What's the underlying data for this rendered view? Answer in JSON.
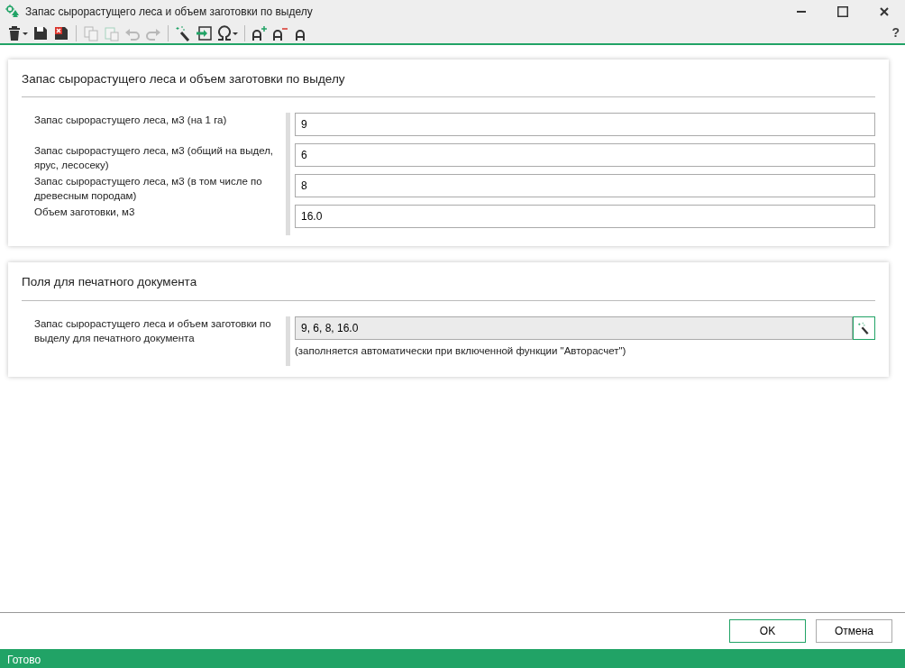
{
  "window": {
    "title": "Запас сырорастущего леса и объем заготовки по выделу",
    "help": "?"
  },
  "toolbar": [
    {
      "kind": "trash",
      "disabled": false,
      "caret": true
    },
    {
      "kind": "save",
      "disabled": false
    },
    {
      "kind": "save-close",
      "disabled": false
    },
    {
      "kind": "sep"
    },
    {
      "kind": "copy",
      "disabled": true
    },
    {
      "kind": "paste",
      "disabled": true
    },
    {
      "kind": "undo",
      "disabled": true
    },
    {
      "kind": "redo",
      "disabled": true
    },
    {
      "kind": "sep"
    },
    {
      "kind": "wand",
      "disabled": false
    },
    {
      "kind": "import",
      "disabled": false
    },
    {
      "kind": "omega",
      "disabled": false,
      "caret": true
    },
    {
      "kind": "sep"
    },
    {
      "kind": "font-up",
      "disabled": false
    },
    {
      "kind": "font-down",
      "disabled": false
    },
    {
      "kind": "font-reset",
      "disabled": false
    }
  ],
  "sections": [
    {
      "title": "Запас сырорастущего леса и объем заготовки по выделу",
      "fields": [
        {
          "label": "Запас сырорастущего леса, м3 (на 1 га)",
          "value": "9",
          "readonly": false
        },
        {
          "label": "Запас сырорастущего леса, м3 (общий на выдел, ярус, лесосеку)",
          "value": "6",
          "readonly": false
        },
        {
          "label": "Запас сырорастущего леса, м3 (в том числе по древесным породам)",
          "value": "8",
          "readonly": false
        },
        {
          "label": "Объем заготовки, м3",
          "value": "16.0",
          "readonly": false
        }
      ]
    },
    {
      "title": "Поля для печатного документа",
      "fields": [
        {
          "label": "Запас сырорастущего леса и объем заготовки по выделу для печатного документа",
          "value": "9, 6, 8, 16.0",
          "readonly": true,
          "hint": "(заполняется автоматически при включенной функции \"Авторасчет\")"
        }
      ]
    }
  ],
  "buttons": [
    {
      "label": "OK",
      "default": true
    },
    {
      "label": "Отмена",
      "default": false
    }
  ],
  "status_bar": "Готово"
}
